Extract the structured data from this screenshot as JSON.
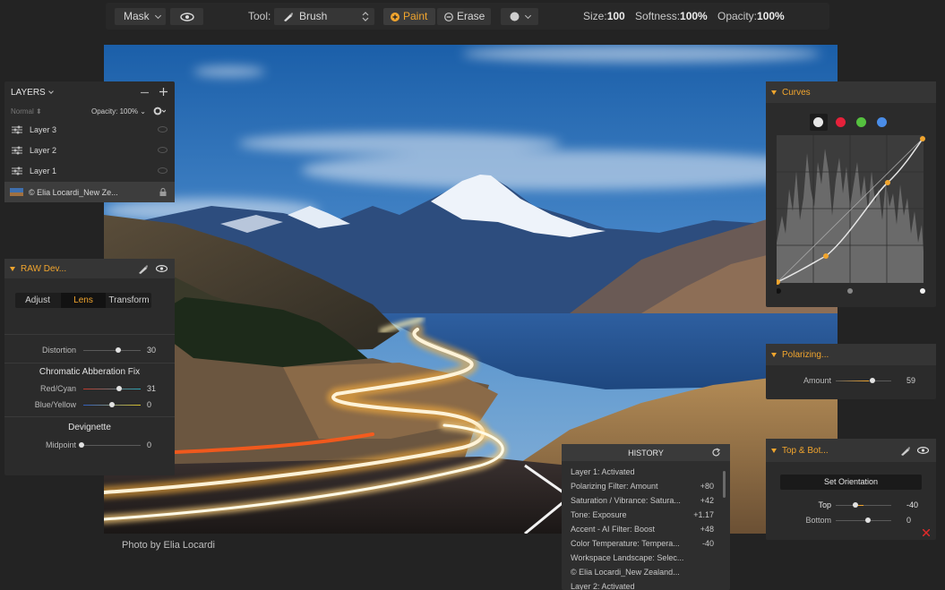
{
  "toolbar": {
    "mask_label": "Mask",
    "tool_label": "Tool:",
    "brush_label": "Brush",
    "paint_label": "Paint",
    "erase_label": "Erase",
    "size_label": "Size:",
    "size_value": "100",
    "softness_label": "Softness:",
    "softness_value": "100%",
    "opacity_label": "Opacity:",
    "opacity_value": "100%"
  },
  "photo": {
    "credit": "Photo by Elia Locardi"
  },
  "layers_panel": {
    "title": "LAYERS",
    "blend_mode": "Normal",
    "opacity_label": "Opacity:",
    "opacity_value": "100%",
    "items": [
      {
        "label": "Layer 3"
      },
      {
        "label": "Layer 2"
      },
      {
        "label": "Layer 1"
      },
      {
        "label": "© Elia Locardi_New Ze..."
      }
    ]
  },
  "raw_panel": {
    "title": "RAW Dev...",
    "tabs": [
      "Adjust",
      "Lens",
      "Transform"
    ],
    "distortion_label": "Distortion",
    "distortion_value": "30",
    "chromatic_title": "Chromatic Abberation Fix",
    "red_cyan_label": "Red/Cyan",
    "red_cyan_value": "31",
    "blue_yellow_label": "Blue/Yellow",
    "blue_yellow_value": "0",
    "devignette_title": "Devignette",
    "midpoint_label": "Midpoint",
    "midpoint_value": "0"
  },
  "curves_panel": {
    "title": "Curves"
  },
  "polarizing_panel": {
    "title": "Polarizing...",
    "amount_label": "Amount",
    "amount_value": "59"
  },
  "topbot_panel": {
    "title": "Top & Bot...",
    "button_label": "Set Orientation",
    "top_label": "Top",
    "top_value": "-40",
    "bottom_label": "Bottom",
    "bottom_value": "0"
  },
  "history_panel": {
    "title": "HISTORY",
    "items": [
      {
        "label": "Layer 1: Activated",
        "value": ""
      },
      {
        "label": "Polarizing Filter: Amount",
        "value": "+80"
      },
      {
        "label": "Saturation / Vibrance: Satura...",
        "value": "+42"
      },
      {
        "label": "Tone: Exposure",
        "value": "+1.17"
      },
      {
        "label": "Accent - AI Filter: Boost",
        "value": "+48"
      },
      {
        "label": "Color Temperature: Tempera...",
        "value": "-40"
      },
      {
        "label": "Workspace Landscape: Selec...",
        "value": ""
      },
      {
        "label": "© Elia Locardi_New Zealand...",
        "value": ""
      },
      {
        "label": "Layer 2: Activated",
        "value": ""
      }
    ]
  },
  "colors": {
    "accent": "#f1a52e",
    "panel_bg": "#2b2b2b",
    "curve_white": "#e6e6e6",
    "curve_red": "#e5213a",
    "curve_green": "#55c13f",
    "curve_blue": "#4a8de8"
  },
  "icons": [
    "eye-icon",
    "brush-icon",
    "plus-icon",
    "minus-icon",
    "gear-icon",
    "lock-icon",
    "adjustments-icon",
    "reset-icon",
    "close-icon"
  ]
}
